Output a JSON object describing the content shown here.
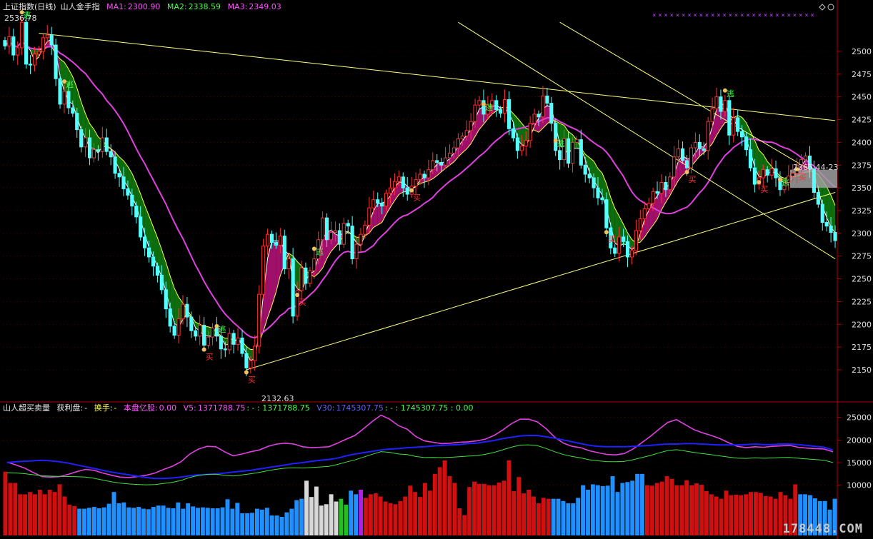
{
  "main_header": {
    "title": "上证指数(日线)",
    "indicator": "山人金手指",
    "ma1_label": "MA1:",
    "ma1": "2300.90",
    "ma2_label": "MA2:",
    "ma2": "2338.59",
    "ma3_label": "MA3:",
    "ma3": "2349.03"
  },
  "sub_header": {
    "indicator": "山人超买卖量",
    "profit_label": "获利盘:",
    "profit_value": "-",
    "turnover_label": "换手:",
    "turnover_value": "-",
    "share_label": "本盘亿股:",
    "share_value": "0.00",
    "v5_label": "V5:",
    "v5": "1371788.75",
    "v5_extra": ": - : 1371788.75",
    "v30_label": "V30:",
    "v30": "1745307.75",
    "v30_extra": ": - : 1745307.75 : 0.00"
  },
  "annotations": {
    "high_label": "2536.78",
    "low_label": "2132.63",
    "range_label": "2365.44-23",
    "buy_marker": "买",
    "escape_marker": "逃"
  },
  "watermark": "178448.COM",
  "colors": {
    "background": "#000000",
    "axis": "#b40000",
    "grid": "#7a0000",
    "up_candle": "#ff3232",
    "down_candle": "#54ffff",
    "ma_magenta": "#e040e0",
    "band_bull": "#a0106a",
    "band_bear": "#0e6e0e",
    "trendline": "#ffff80",
    "volume_red": "#d01010",
    "volume_blue": "#1e90ff",
    "volume_gray": "#d8d8d8",
    "volume_green": "#20c020",
    "volume_purple": "#b020e0",
    "v30_line": "#2020ff",
    "v5_line": "#e040e0",
    "green_line": "#40e040",
    "star_row": "#c040ff"
  },
  "chart_data": [
    {
      "type": "candlestick",
      "title": "上证指数(日线)",
      "y_ticks": [
        2150,
        2175,
        2200,
        2225,
        2250,
        2275,
        2300,
        2325,
        2350,
        2375,
        2400,
        2425,
        2450,
        2475,
        2500
      ],
      "ylim": [
        2105,
        2530
      ],
      "high": 2536.78,
      "low": 2132.63,
      "close": [
        2506,
        2516,
        2496,
        2504,
        2532,
        2486,
        2485,
        2497,
        2500,
        2515,
        2518,
        2507,
        2470,
        2442,
        2456,
        2438,
        2432,
        2414,
        2395,
        2405,
        2383,
        2392,
        2390,
        2405,
        2390,
        2384,
        2366,
        2362,
        2349,
        2342,
        2330,
        2318,
        2296,
        2284,
        2274,
        2264,
        2254,
        2238,
        2217,
        2198,
        2188,
        2206,
        2222,
        2208,
        2193,
        2187,
        2199,
        2177,
        2186,
        2196,
        2187,
        2173,
        2172,
        2190,
        2178,
        2185,
        2168,
        2152,
        2160,
        2176,
        2233,
        2286,
        2299,
        2290,
        2287,
        2297,
        2261,
        2272,
        2209,
        2237,
        2262,
        2245,
        2259,
        2272,
        2293,
        2317,
        2293,
        2301,
        2303,
        2288,
        2311,
        2308,
        2272,
        2288,
        2299,
        2309,
        2328,
        2337,
        2333,
        2330,
        2344,
        2350,
        2357,
        2362,
        2350,
        2343,
        2352,
        2359,
        2365,
        2361,
        2370,
        2380,
        2378,
        2375,
        2383,
        2388,
        2394,
        2404,
        2407,
        2413,
        2423,
        2441,
        2446,
        2431,
        2441,
        2446,
        2436,
        2432,
        2447,
        2415,
        2405,
        2391,
        2396,
        2402,
        2421,
        2431,
        2428,
        2451,
        2443,
        2421,
        2391,
        2381,
        2404,
        2377,
        2400,
        2403,
        2375,
        2365,
        2361,
        2350,
        2339,
        2337,
        2306,
        2284,
        2278,
        2296,
        2291,
        2274,
        2281,
        2303,
        2316,
        2327,
        2333,
        2346,
        2344,
        2356,
        2348,
        2362,
        2384,
        2393,
        2380,
        2372,
        2394,
        2400,
        2393,
        2391,
        2423,
        2437,
        2450,
        2434,
        2446,
        2408,
        2427,
        2412,
        2406,
        2392,
        2372,
        2354,
        2361,
        2370,
        2364,
        2371,
        2361,
        2348,
        2356,
        2363,
        2366,
        2375,
        2381,
        2385,
        2371,
        2345,
        2332,
        2312,
        2308,
        2301,
        2292
      ]
    },
    {
      "type": "bar+line",
      "title": "山人超买卖量",
      "y_ticks": [
        10000,
        15000,
        20000,
        25000
      ],
      "ylim": [
        0,
        28000
      ],
      "series": [
        {
          "name": "V5",
          "values": [
            15100,
            14500,
            13800,
            12800,
            11900,
            11800,
            11900,
            12400,
            13000,
            13500,
            13300,
            12700,
            12200,
            11800,
            11700,
            11900,
            12200,
            12700,
            13500,
            14200,
            15200,
            16900,
            18000,
            18600,
            18500,
            17400,
            16500,
            16900,
            17400,
            17800,
            18600,
            19100,
            19300,
            19100,
            18500,
            18300,
            18400,
            18500,
            19300,
            20200,
            21000,
            22500,
            24100,
            25500,
            24600,
            23200,
            22400,
            20800,
            19800,
            19500,
            19200,
            19300,
            19500,
            19600,
            19800,
            20200,
            21000,
            22200,
            23600,
            24600,
            24600,
            24000,
            22500,
            20600,
            19300,
            18600,
            18300,
            17600,
            17200,
            16800,
            16700,
            17000,
            18000,
            19400,
            20800,
            22400,
            23900,
            24500,
            23400,
            22300,
            21600,
            21000,
            20300,
            19400,
            18600,
            18300,
            18500,
            18400,
            18600,
            18700,
            18800,
            18400,
            18200,
            18100,
            18000,
            17400
          ]
        },
        {
          "name": "V30",
          "values": [
            15000,
            15200,
            15300,
            15400,
            15500,
            15400,
            15200,
            14900,
            14500,
            14100,
            13700,
            13300,
            12900,
            12600,
            12300,
            12000,
            11700,
            11500,
            11500,
            11600,
            11800,
            12100,
            12300,
            12400,
            12500,
            12700,
            12900,
            13100,
            13300,
            13600,
            13900,
            14200,
            14500,
            14800,
            15000,
            15300,
            15500,
            15700,
            16000,
            16500,
            16900,
            17200,
            17500,
            17800,
            18000,
            18100,
            18300,
            18400,
            18500,
            18700,
            18800,
            18900,
            19000,
            19200,
            19300,
            19600,
            19900,
            20300,
            20600,
            20900,
            21000,
            21000,
            20700,
            20400,
            20000,
            19600,
            19200,
            18800,
            18600,
            18500,
            18500,
            18500,
            18600,
            18700,
            18800,
            19000,
            19100,
            19100,
            19200,
            19200,
            19100,
            19000,
            18900,
            18900,
            18900,
            19000,
            19100,
            19000,
            19000,
            19100,
            19100,
            19000,
            18800,
            18600,
            18400,
            17800
          ]
        }
      ],
      "volume": [
        13000,
        10500,
        10500,
        8000,
        8000,
        8500,
        8000,
        9000,
        8000,
        9000,
        8500,
        10200,
        7500,
        5700,
        5400,
        4800,
        4800,
        5000,
        5200,
        4900,
        5100,
        5900,
        8500,
        6000,
        6200,
        5100,
        5000,
        5200,
        4800,
        4700,
        5200,
        5500,
        5500,
        5000,
        4900,
        6200,
        4800,
        6000,
        5300,
        5000,
        5100,
        5000,
        4900,
        4900,
        5100,
        6900,
        4800,
        6100,
        3800,
        3800,
        3900,
        4800,
        4600,
        5000,
        3300,
        3300,
        3000,
        4000,
        4800,
        6700,
        7000,
        11000,
        7400,
        9700,
        5500,
        5800,
        8000,
        6400,
        7000,
        5700,
        8800,
        8000,
        9000,
        7200,
        8000,
        8200,
        7500,
        6400,
        6000,
        5800,
        6500,
        7500,
        9900,
        8500,
        7400,
        10500,
        8800,
        12500,
        14000,
        15500,
        12000,
        10500,
        4900,
        3400,
        9600,
        10800,
        10300,
        10300,
        10000,
        10000,
        10600,
        11000,
        15500,
        8700,
        11800,
        8200,
        9000,
        7500,
        6000,
        7200,
        7000,
        7000,
        7000,
        6500,
        6000,
        6000,
        7200,
        10000,
        9000,
        10200,
        10000,
        9800,
        9900,
        12000,
        8500,
        10500,
        10700,
        11000,
        12500,
        12500,
        10000,
        9900,
        10500,
        10800,
        12000,
        11400,
        10000,
        10000,
        11100,
        10000,
        10400,
        10100,
        8700,
        8000,
        7500,
        7000,
        8800,
        7800,
        7900,
        7800,
        8000,
        8500,
        8500,
        8300,
        7600,
        7500,
        7000,
        8500,
        7800,
        7000,
        10200,
        8000,
        8000,
        7800,
        7100,
        6500,
        6500,
        4600,
        7000
      ]
    }
  ]
}
